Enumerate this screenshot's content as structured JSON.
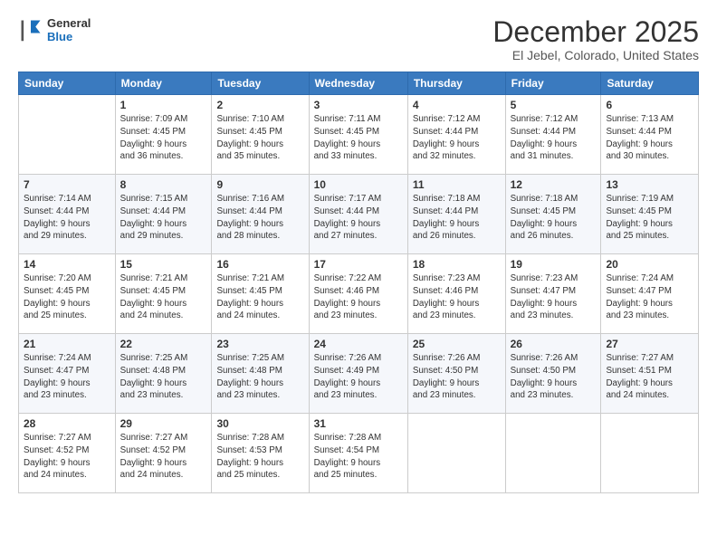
{
  "logo": {
    "line1": "General",
    "line2": "Blue"
  },
  "title": "December 2025",
  "subtitle": "El Jebel, Colorado, United States",
  "weekdays": [
    "Sunday",
    "Monday",
    "Tuesday",
    "Wednesday",
    "Thursday",
    "Friday",
    "Saturday"
  ],
  "weeks": [
    [
      {
        "day": "",
        "info": ""
      },
      {
        "day": "1",
        "info": "Sunrise: 7:09 AM\nSunset: 4:45 PM\nDaylight: 9 hours\nand 36 minutes."
      },
      {
        "day": "2",
        "info": "Sunrise: 7:10 AM\nSunset: 4:45 PM\nDaylight: 9 hours\nand 35 minutes."
      },
      {
        "day": "3",
        "info": "Sunrise: 7:11 AM\nSunset: 4:45 PM\nDaylight: 9 hours\nand 33 minutes."
      },
      {
        "day": "4",
        "info": "Sunrise: 7:12 AM\nSunset: 4:44 PM\nDaylight: 9 hours\nand 32 minutes."
      },
      {
        "day": "5",
        "info": "Sunrise: 7:12 AM\nSunset: 4:44 PM\nDaylight: 9 hours\nand 31 minutes."
      },
      {
        "day": "6",
        "info": "Sunrise: 7:13 AM\nSunset: 4:44 PM\nDaylight: 9 hours\nand 30 minutes."
      }
    ],
    [
      {
        "day": "7",
        "info": "Sunrise: 7:14 AM\nSunset: 4:44 PM\nDaylight: 9 hours\nand 29 minutes."
      },
      {
        "day": "8",
        "info": "Sunrise: 7:15 AM\nSunset: 4:44 PM\nDaylight: 9 hours\nand 29 minutes."
      },
      {
        "day": "9",
        "info": "Sunrise: 7:16 AM\nSunset: 4:44 PM\nDaylight: 9 hours\nand 28 minutes."
      },
      {
        "day": "10",
        "info": "Sunrise: 7:17 AM\nSunset: 4:44 PM\nDaylight: 9 hours\nand 27 minutes."
      },
      {
        "day": "11",
        "info": "Sunrise: 7:18 AM\nSunset: 4:44 PM\nDaylight: 9 hours\nand 26 minutes."
      },
      {
        "day": "12",
        "info": "Sunrise: 7:18 AM\nSunset: 4:45 PM\nDaylight: 9 hours\nand 26 minutes."
      },
      {
        "day": "13",
        "info": "Sunrise: 7:19 AM\nSunset: 4:45 PM\nDaylight: 9 hours\nand 25 minutes."
      }
    ],
    [
      {
        "day": "14",
        "info": "Sunrise: 7:20 AM\nSunset: 4:45 PM\nDaylight: 9 hours\nand 25 minutes."
      },
      {
        "day": "15",
        "info": "Sunrise: 7:21 AM\nSunset: 4:45 PM\nDaylight: 9 hours\nand 24 minutes."
      },
      {
        "day": "16",
        "info": "Sunrise: 7:21 AM\nSunset: 4:45 PM\nDaylight: 9 hours\nand 24 minutes."
      },
      {
        "day": "17",
        "info": "Sunrise: 7:22 AM\nSunset: 4:46 PM\nDaylight: 9 hours\nand 23 minutes."
      },
      {
        "day": "18",
        "info": "Sunrise: 7:23 AM\nSunset: 4:46 PM\nDaylight: 9 hours\nand 23 minutes."
      },
      {
        "day": "19",
        "info": "Sunrise: 7:23 AM\nSunset: 4:47 PM\nDaylight: 9 hours\nand 23 minutes."
      },
      {
        "day": "20",
        "info": "Sunrise: 7:24 AM\nSunset: 4:47 PM\nDaylight: 9 hours\nand 23 minutes."
      }
    ],
    [
      {
        "day": "21",
        "info": "Sunrise: 7:24 AM\nSunset: 4:47 PM\nDaylight: 9 hours\nand 23 minutes."
      },
      {
        "day": "22",
        "info": "Sunrise: 7:25 AM\nSunset: 4:48 PM\nDaylight: 9 hours\nand 23 minutes."
      },
      {
        "day": "23",
        "info": "Sunrise: 7:25 AM\nSunset: 4:48 PM\nDaylight: 9 hours\nand 23 minutes."
      },
      {
        "day": "24",
        "info": "Sunrise: 7:26 AM\nSunset: 4:49 PM\nDaylight: 9 hours\nand 23 minutes."
      },
      {
        "day": "25",
        "info": "Sunrise: 7:26 AM\nSunset: 4:50 PM\nDaylight: 9 hours\nand 23 minutes."
      },
      {
        "day": "26",
        "info": "Sunrise: 7:26 AM\nSunset: 4:50 PM\nDaylight: 9 hours\nand 23 minutes."
      },
      {
        "day": "27",
        "info": "Sunrise: 7:27 AM\nSunset: 4:51 PM\nDaylight: 9 hours\nand 24 minutes."
      }
    ],
    [
      {
        "day": "28",
        "info": "Sunrise: 7:27 AM\nSunset: 4:52 PM\nDaylight: 9 hours\nand 24 minutes."
      },
      {
        "day": "29",
        "info": "Sunrise: 7:27 AM\nSunset: 4:52 PM\nDaylight: 9 hours\nand 24 minutes."
      },
      {
        "day": "30",
        "info": "Sunrise: 7:28 AM\nSunset: 4:53 PM\nDaylight: 9 hours\nand 25 minutes."
      },
      {
        "day": "31",
        "info": "Sunrise: 7:28 AM\nSunset: 4:54 PM\nDaylight: 9 hours\nand 25 minutes."
      },
      {
        "day": "",
        "info": ""
      },
      {
        "day": "",
        "info": ""
      },
      {
        "day": "",
        "info": ""
      }
    ]
  ]
}
